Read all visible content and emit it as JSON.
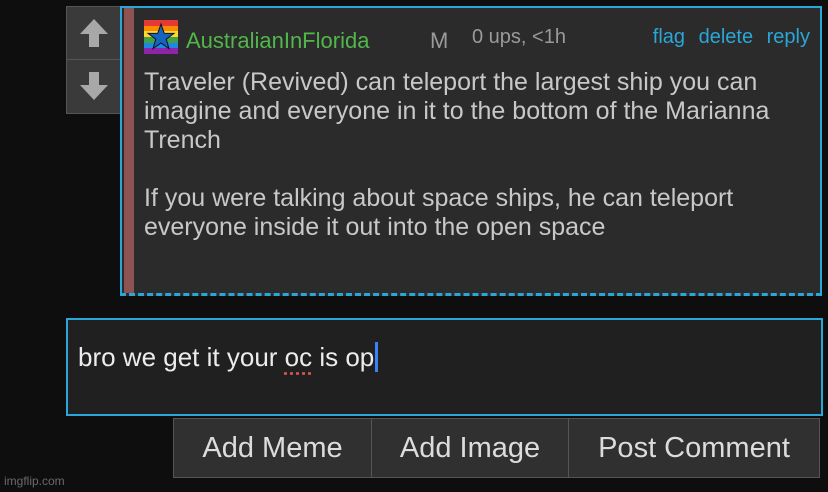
{
  "comment": {
    "username": "AustralianInFlorida",
    "mod_badge": "M",
    "meta": "0 ups, <1h",
    "actions": {
      "flag": "flag",
      "delete": "delete",
      "reply": "reply"
    },
    "paragraphs": [
      "Traveler (Revived) can teleport the largest ship you can imagine and everyone in it to the bottom of the Marianna Trench",
      "If you were talking about space ships, he can teleport everyone inside it out into the open space"
    ]
  },
  "reply": {
    "text_before": "bro we get it your ",
    "text_misspelled": "oc",
    "text_after": " is op"
  },
  "buttons": {
    "add_meme": "Add Meme",
    "add_image": "Add Image",
    "post_comment": "Post Comment"
  },
  "watermark": "imgflip.com",
  "icons": {
    "upvote": "arrow-up-icon",
    "downvote": "arrow-down-icon",
    "user_flag": "rainbow-star-flag-icon"
  },
  "colors": {
    "accent": "#2aa6d8",
    "username": "#52b74a",
    "depth_bar": "#8d5252"
  }
}
